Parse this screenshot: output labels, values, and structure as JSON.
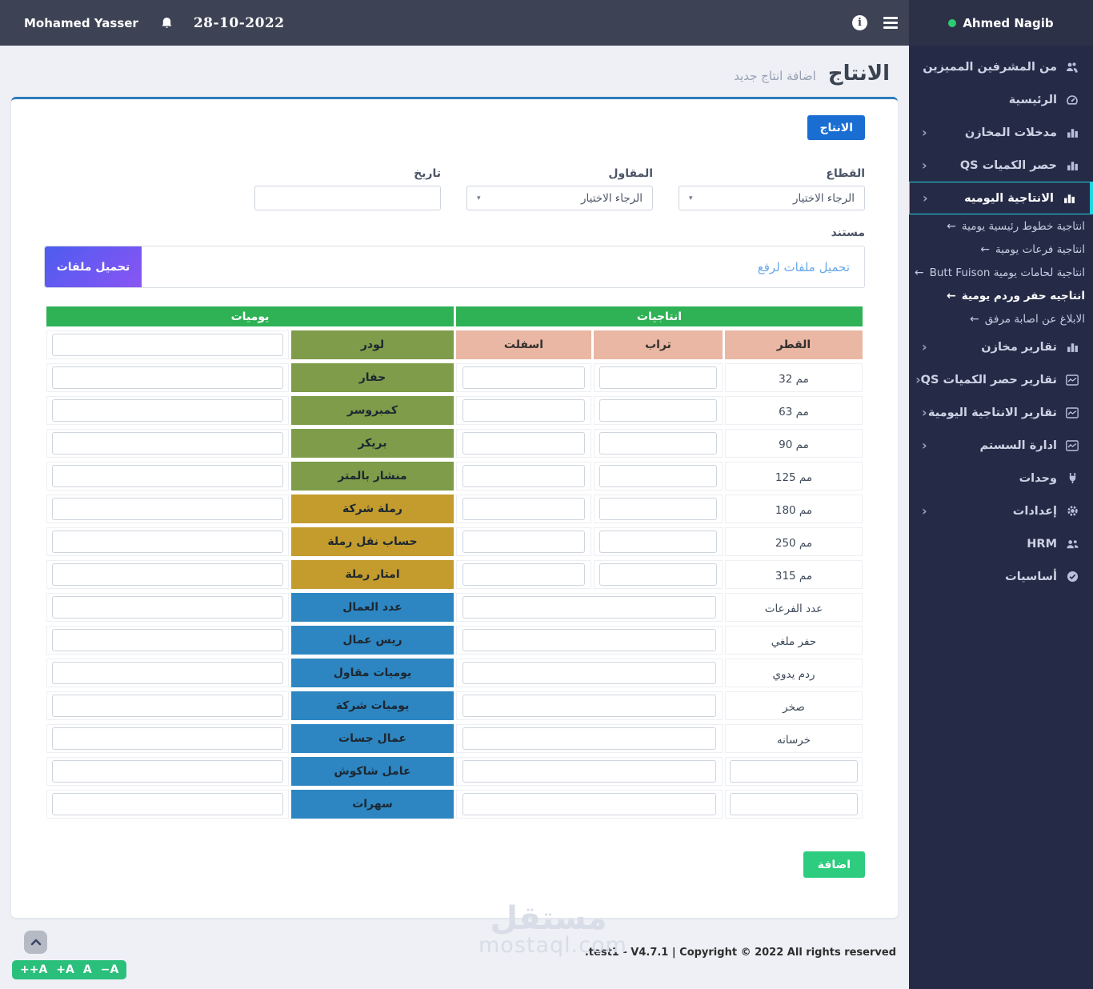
{
  "navbar": {
    "user": "Mohamed Yasser",
    "date": "28-10-2022"
  },
  "sidebar": {
    "user": "Ahmed Nagib",
    "submenu_arrow": "←",
    "menu": [
      {
        "type": "item",
        "label": "من المشرفين المميزين",
        "icon": "users-gear",
        "chevron": false,
        "active": false
      },
      {
        "type": "item",
        "label": "الرئيسية",
        "icon": "dashboard",
        "chevron": false,
        "active": false
      },
      {
        "type": "item",
        "label": "مدخلات المخازن",
        "icon": "bar-chart",
        "chevron": true,
        "active": false
      },
      {
        "type": "item",
        "label": "حصر الكميات QS",
        "icon": "bar-chart",
        "chevron": true,
        "active": false
      },
      {
        "type": "item",
        "label": "الانتاجية اليوميه",
        "icon": "bar-chart",
        "chevron": true,
        "active": true
      },
      {
        "type": "sub",
        "label": "انتاجية خطوط رئيسية يومية",
        "active": false
      },
      {
        "type": "sub",
        "label": "انتاجية فرعات يومية",
        "active": false
      },
      {
        "type": "sub",
        "label": "انتاجية لحامات يومية Butt Fuison",
        "active": false
      },
      {
        "type": "sub",
        "label": "انتاجيه حفر وردم يومية",
        "active": true
      },
      {
        "type": "sub",
        "label": "الابلاغ عن اصابة مرفق",
        "active": false
      },
      {
        "type": "item",
        "label": "تقارير مخازن",
        "icon": "bar-chart",
        "chevron": true,
        "active": false
      },
      {
        "type": "item",
        "label": "تقارير حصر الكميات QS",
        "icon": "line-chart",
        "chevron": true,
        "active": false
      },
      {
        "type": "item",
        "label": "تقارير الانتاجية اليومية",
        "icon": "line-chart",
        "chevron": true,
        "active": false
      },
      {
        "type": "item",
        "label": "ادارة السستم",
        "icon": "line-chart",
        "chevron": true,
        "active": false
      },
      {
        "type": "item",
        "label": "وحدات",
        "icon": "plug",
        "chevron": false,
        "active": false
      },
      {
        "type": "item",
        "label": "إعدادات",
        "icon": "gear",
        "chevron": true,
        "active": false
      },
      {
        "type": "item",
        "label": "HRM",
        "icon": "users",
        "chevron": false,
        "active": false
      },
      {
        "type": "item",
        "label": "أساسيات",
        "icon": "check-circle",
        "chevron": false,
        "active": false
      }
    ]
  },
  "page": {
    "title": "الانتاج",
    "subtitle": "اضافة انتاج جديد"
  },
  "toolbar": {
    "tab_label": "الانتاج"
  },
  "form": {
    "sector_label": "القطاع",
    "sector_value": "الرجاء الاختيار",
    "contractor_label": "المقاول",
    "contractor_value": "الرجاء الاختيار",
    "date_label": "تاريخ",
    "date_value": "",
    "document_label": "مستند",
    "upload_placeholder": "تحميل ملفات لرفع",
    "upload_button": "تحميل ملفات",
    "submit_button": "اضافة"
  },
  "table": {
    "group_right": "انتاجيات",
    "group_left": "يوميات",
    "columns": [
      "القطر",
      "تراب",
      "اسفلت"
    ],
    "diameter_rows": [
      "32 مم",
      "63 مم",
      "90 مم",
      "125 مم",
      "180 مم",
      "250 مم",
      "315 مم"
    ],
    "wide_rows": [
      "عدد الفرعات",
      "حفر ملغي",
      "ردم يدوي",
      "صخر",
      "خرسانه"
    ],
    "custom_input_rows": 2,
    "daily_rows": [
      {
        "label": "لودر",
        "color": "olive"
      },
      {
        "label": "حفار",
        "color": "olive"
      },
      {
        "label": "كمبروسر",
        "color": "olive"
      },
      {
        "label": "بريكر",
        "color": "olive"
      },
      {
        "label": "منشار بالمتر",
        "color": "olive"
      },
      {
        "label": "رملة شركة",
        "color": "mustard"
      },
      {
        "label": "حساب نقل رملة",
        "color": "mustard"
      },
      {
        "label": "امتار رملة",
        "color": "mustard"
      },
      {
        "label": "عدد العمال",
        "color": "blue"
      },
      {
        "label": "ريس عمال",
        "color": "blue"
      },
      {
        "label": "يوميات مقاول",
        "color": "blue"
      },
      {
        "label": "يوميات شركة",
        "color": "blue"
      },
      {
        "label": "عمال جسات",
        "color": "blue"
      },
      {
        "label": "عامل شاكوش",
        "color": "blue"
      },
      {
        "label": "سهرات",
        "color": "blue"
      }
    ]
  },
  "footer": {
    "copyright": ".test1 - V4.7.1 | Copyright © 2022 All rights reserved"
  },
  "watermark": {
    "logo": "مستقل",
    "site": "mostaql.com"
  },
  "floating": {
    "font_size_buttons": [
      "++A",
      "+A",
      "A",
      "−A"
    ]
  },
  "colors": {
    "accent_cyan": "#24d4e0",
    "primary_blue": "#1a6ed1",
    "table_green": "#2fb156",
    "salmon": "#e9b7a3",
    "olive": "#7e9c49",
    "mustard": "#c39c2d",
    "cell_blue": "#2d86c1",
    "success_green": "#2ecc7e",
    "upload_gradient_start": "#4d5cf0",
    "upload_gradient_end": "#8a55f3"
  }
}
